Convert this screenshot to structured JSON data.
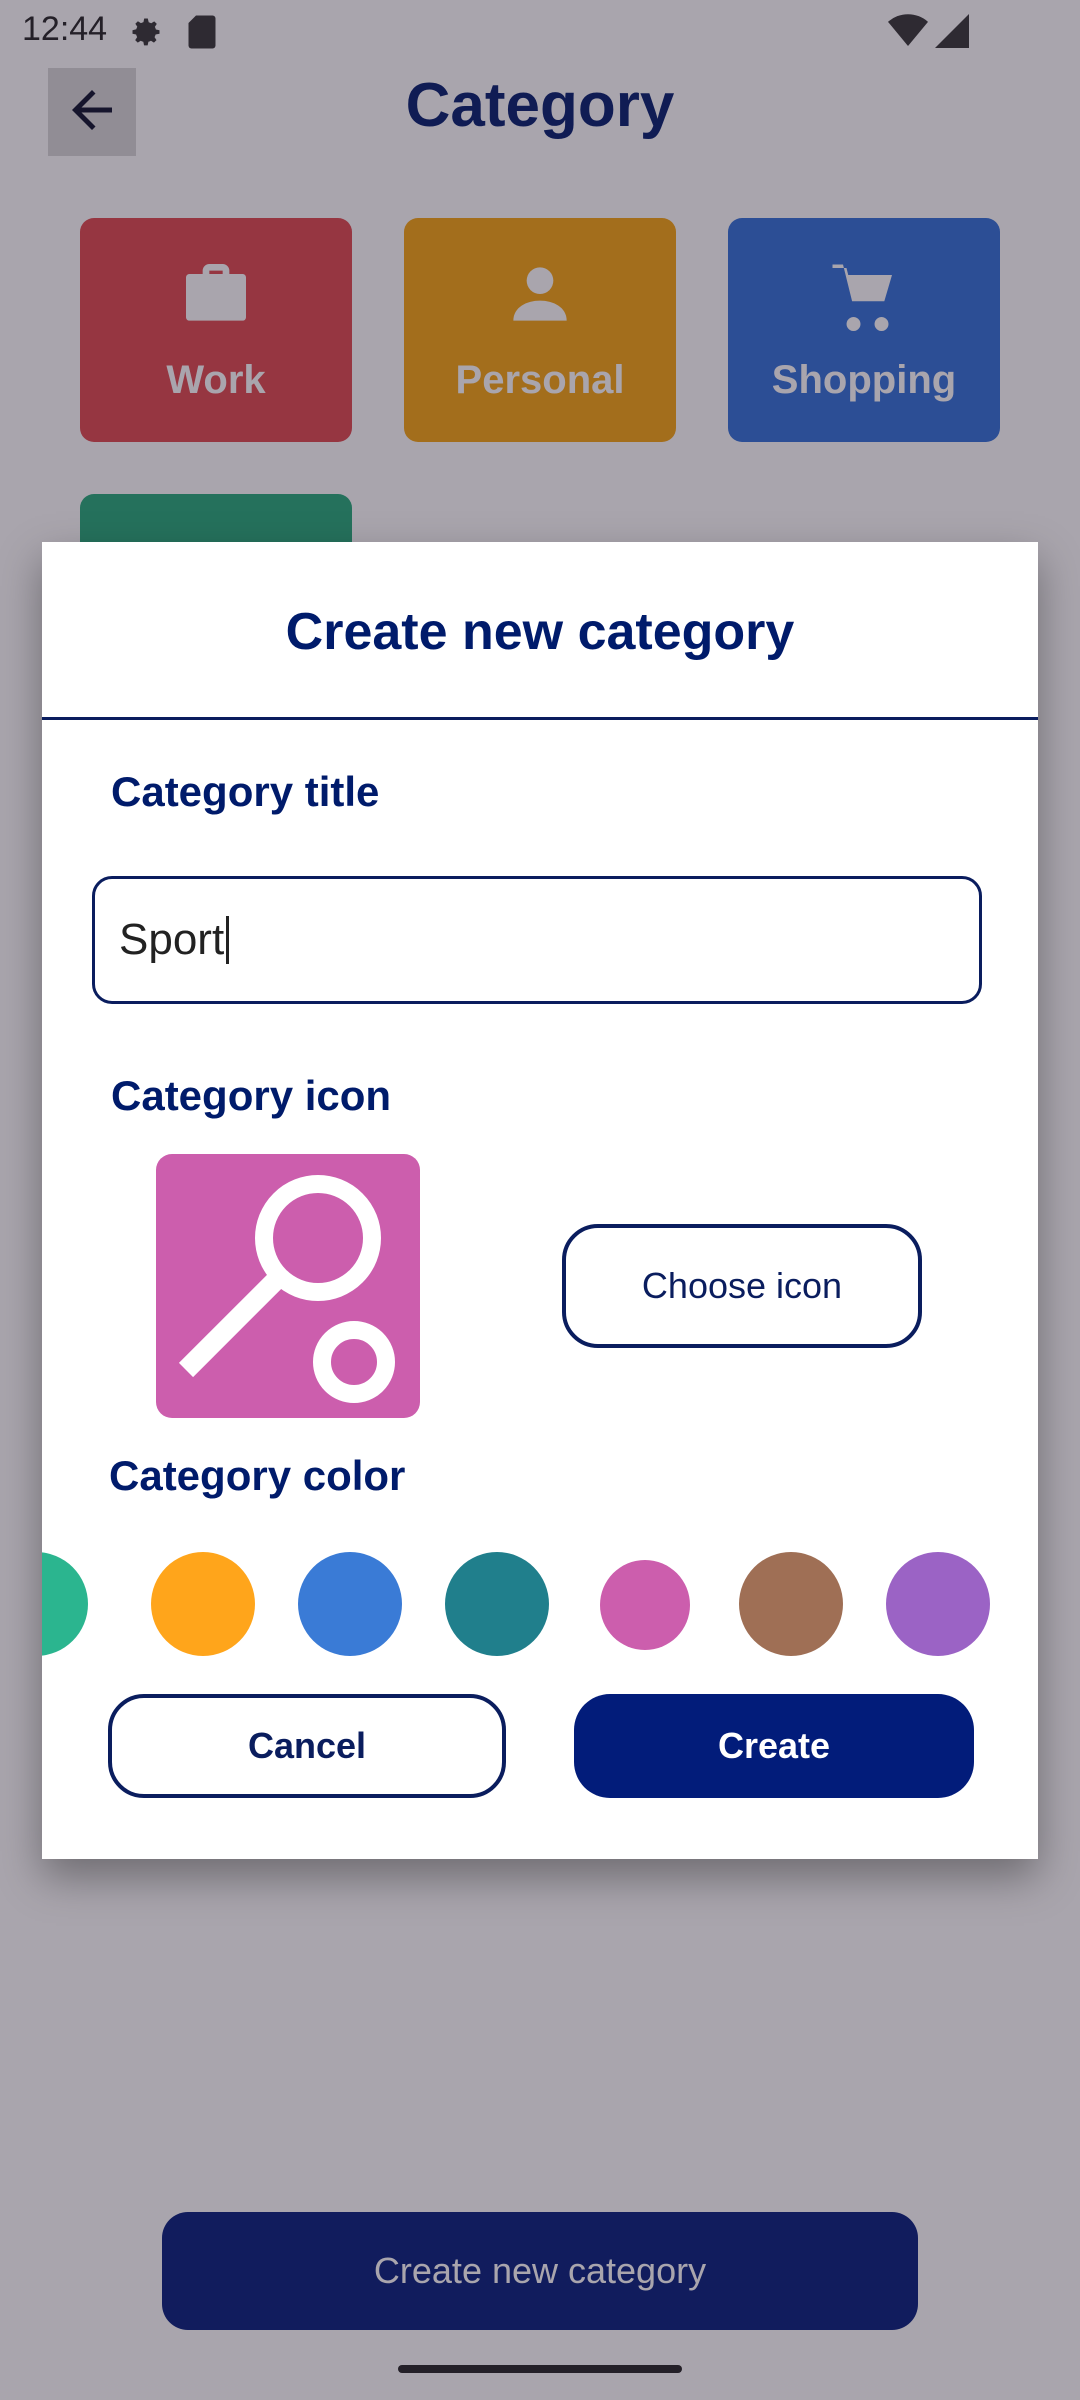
{
  "status_bar": {
    "time": "12:44",
    "icons": [
      "settings-gear-icon",
      "sd-card-icon",
      "wifi-icon",
      "cell-signal-icon"
    ]
  },
  "header": {
    "title": "Category",
    "back_icon": "arrow-left-icon"
  },
  "categories": [
    {
      "label": "Work",
      "icon": "briefcase-icon",
      "color": "#e0474c"
    },
    {
      "label": "Personal",
      "icon": "person-icon",
      "color": "#f5a40e"
    },
    {
      "label": "Shopping",
      "icon": "cart-icon",
      "color": "#2f6fd8"
    }
  ],
  "partial_category": {
    "color": "#23a878"
  },
  "bottom_button": {
    "label": "Create new category"
  },
  "dialog": {
    "title": "Create new category",
    "title_label": "Category title",
    "title_value": "Sport",
    "icon_label": "Category icon",
    "selected_icon": "tennis-racket-icon",
    "selected_icon_color": "#cc5ead",
    "choose_icon_label": "Choose icon",
    "color_label": "Category color",
    "colors": [
      "#2bb58f",
      "#ffa51b",
      "#3a7bd6",
      "#207f8c",
      "#cc5ead",
      "#9f6f55",
      "#9b63c5"
    ],
    "selected_color": "#cc5ead",
    "cancel_label": "Cancel",
    "create_label": "Create"
  }
}
